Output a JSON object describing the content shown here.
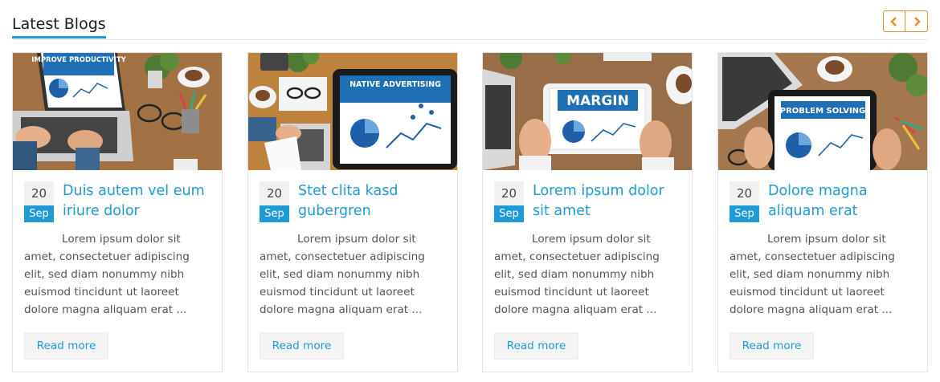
{
  "section": {
    "title": "Latest Blogs"
  },
  "nav": {
    "prev_icon": "chevron-left-icon",
    "next_icon": "chevron-right-icon",
    "accent_color": "#e98a2a"
  },
  "colors": {
    "primary": "#1f9ad6",
    "badge_day_bg": "#f1f1f1"
  },
  "posts": [
    {
      "day": "20",
      "month": "Sep",
      "title": "Duis autem vel eum iriure dolor",
      "excerpt": "Lorem ipsum dolor sit amet, consectetuer adipiscing elit, sed diam nonummy nibh euismod tincidunt ut laoreet dolore magna aliquam erat ...",
      "read_more": "Read more",
      "image_caption": "IMPROVE PRODUCTIVITY"
    },
    {
      "day": "20",
      "month": "Sep",
      "title": "Stet clita kasd gubergren",
      "excerpt": "Lorem ipsum dolor sit amet, consectetuer adipiscing elit, sed diam nonummy nibh euismod tincidunt ut laoreet dolore magna aliquam erat ...",
      "read_more": "Read more",
      "image_caption": "NATIVE ADVERTISING"
    },
    {
      "day": "20",
      "month": "Sep",
      "title": "Lorem ipsum dolor sit amet",
      "excerpt": "Lorem ipsum dolor sit amet, consectetuer adipiscing elit, sed diam nonummy nibh euismod tincidunt ut laoreet dolore magna aliquam erat ...",
      "read_more": "Read more",
      "image_caption": "MARGIN"
    },
    {
      "day": "20",
      "month": "Sep",
      "title": "Dolore magna aliquam erat",
      "excerpt": "Lorem ipsum dolor sit amet, consectetuer adipiscing elit, sed diam nonummy nibh euismod tincidunt ut laoreet dolore magna aliquam erat ...",
      "read_more": "Read more",
      "image_caption": "PROBLEM SOLVING"
    }
  ]
}
